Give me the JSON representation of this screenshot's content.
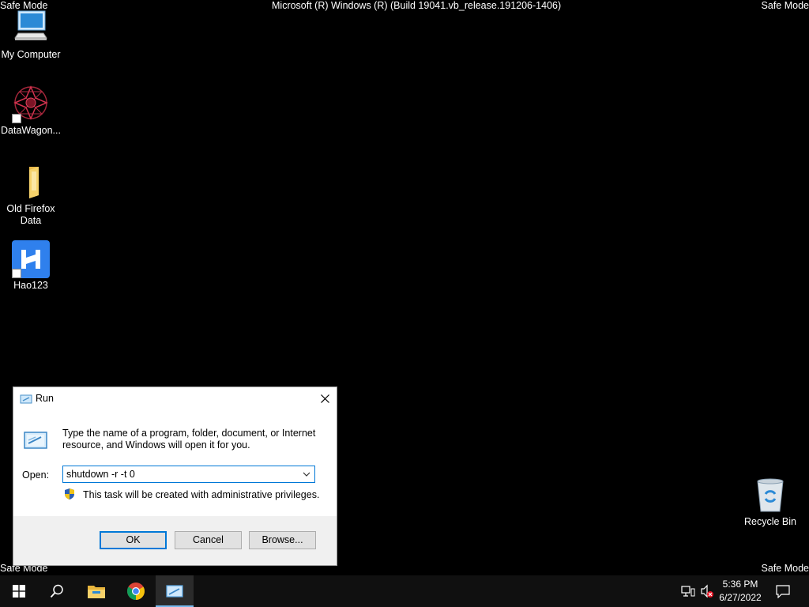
{
  "overlay": {
    "safe_mode_tl": "Safe Mode",
    "safe_mode_tr": "Safe Mode",
    "safe_mode_bl": "Safe Mode",
    "safe_mode_br": "Safe Mode",
    "build": "Microsoft (R) Windows (R) (Build 19041.vb_release.191206-1406)"
  },
  "desktop": {
    "icons": [
      {
        "label": "My Computer",
        "icon": "computer-icon"
      },
      {
        "label": "DataWagon...",
        "icon": "datawagon-icon"
      },
      {
        "label": "Old Firefox Data",
        "icon": "folder-icon"
      },
      {
        "label": "Hao123",
        "icon": "hao123-icon"
      },
      {
        "label": "Recycle Bin",
        "icon": "recycle-bin-icon"
      }
    ]
  },
  "run_dialog": {
    "title": "Run",
    "description": "Type the name of a program, folder, document, or Internet resource, and Windows will open it for you.",
    "open_label": "Open:",
    "input_value": "shutdown -r -t 0",
    "admin_note": "This task will be created with administrative privileges.",
    "ok_label": "OK",
    "cancel_label": "Cancel",
    "browse_label": "Browse..."
  },
  "taskbar": {
    "apps": [
      "start-icon",
      "search-icon",
      "file-explorer-icon",
      "chrome-icon",
      "run-icon"
    ],
    "time": "5:36 PM",
    "date": "6/27/2022"
  },
  "colors": {
    "accent": "#0078d7",
    "taskbar": "#101010",
    "desktop": "#000000"
  }
}
